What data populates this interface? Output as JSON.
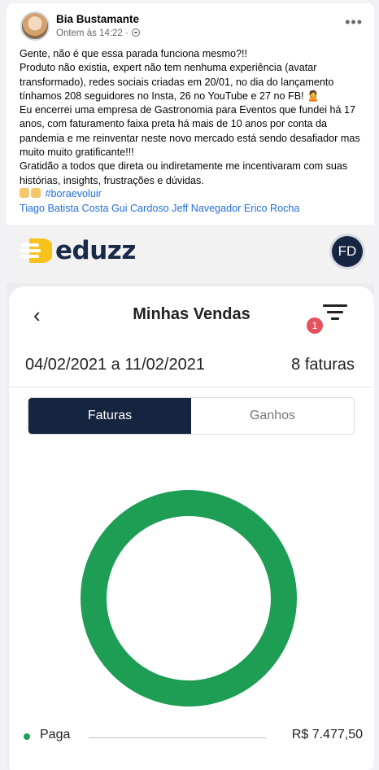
{
  "post": {
    "author": "Bia Bustamante",
    "timestamp": "Ontem às 14:22 · ",
    "more_icon": "more-horizontal-icon",
    "body": "Gente, não é que essa parada funciona mesmo?!!\nProduto não existia, expert não tem nenhuma experiência (avatar transformado), redes sociais criadas em 20/01, no dia do lançamento tínhamos 208 seguidores no Insta, 26 no YouTube e 27 no FB! 🙎\nEu encerrei uma empresa de Gastronomia para Eventos que fundei há 17 anos, com faturamento faixa preta há mais de 10 anos por conta da pandemia e me reinventar neste novo mercado está sendo desafiador mas muito muito gratificante!!!\nGratidão a todos que direta ou indiretamente me incentivaram com suas histórias, insights, frustrações e dúvidas.",
    "hashtag": "#boraevoluir",
    "tagged": [
      "Tiago Batista",
      "Costa",
      "Gui Cardoso",
      "Jeff Navegador",
      "Erico Rocha"
    ]
  },
  "app": {
    "brand": "eduzz",
    "user_initials": "FD",
    "screen_title": "Minhas Vendas",
    "filter_badge": "1",
    "date_range": "04/02/2021 a 11/02/2021",
    "invoice_count": "8 faturas",
    "tabs": {
      "active": "Faturas",
      "inactive": "Ganhos"
    }
  },
  "chart_data": {
    "type": "pie",
    "donut": true,
    "categories": [
      "Paga"
    ],
    "values": [
      7477.5
    ],
    "percent_labels": [
      "100%"
    ],
    "value_labels": [
      "R$  7.477,50"
    ],
    "colors": [
      "#1e9d54"
    ]
  },
  "colors": {
    "facebook_link": "#216fdb",
    "eduzz_navy": "#15243f",
    "eduzz_yellow": "#f7c31b",
    "paid_green": "#1e9d54",
    "badge_red": "#e5525f"
  }
}
